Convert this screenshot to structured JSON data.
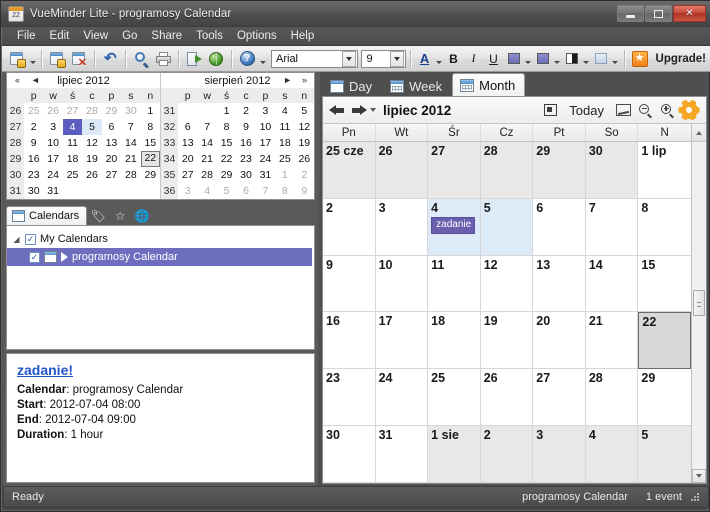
{
  "window": {
    "title": "VueMinder Lite - programosy Calendar",
    "app_icon": "calendar-icon",
    "icon_day_number": "22",
    "buttons": {
      "minimize": "minimize",
      "maximize": "maximize",
      "close": "✕"
    }
  },
  "menubar": {
    "items": [
      "File",
      "Edit",
      "View",
      "Go",
      "Share",
      "Tools",
      "Options",
      "Help"
    ]
  },
  "toolbar": {
    "buttons": [
      {
        "name": "new-event-icon",
        "label": "New Event"
      },
      {
        "name": "new-task-icon",
        "label": "New Task"
      },
      {
        "name": "delete-icon",
        "label": "Delete"
      },
      {
        "name": "undo-icon",
        "label": "Undo"
      },
      {
        "name": "search-icon",
        "label": "Search"
      },
      {
        "name": "print-icon",
        "label": "Print"
      },
      {
        "name": "import-icon",
        "label": "Import"
      },
      {
        "name": "globe-icon",
        "label": "Online"
      },
      {
        "name": "help-icon",
        "label": "Help"
      }
    ],
    "font_name": "Arial",
    "font_size": "9",
    "font_color_label": "A",
    "bold_label": "B",
    "italic_label": "I",
    "underline_label": "U",
    "upgrade_label": "Upgrade!",
    "upgrade_icon": "star-icon"
  },
  "minicals": [
    {
      "title": "lipiec 2012",
      "nav_prev_all": "«",
      "nav_prev": "◄",
      "nav_next": "",
      "nav_next_all": "",
      "dow": [
        "p",
        "w",
        "ś",
        "c",
        "p",
        "s",
        "n"
      ],
      "weeks": [
        {
          "num": "26",
          "days": [
            {
              "d": "25",
              "s": "out"
            },
            {
              "d": "26",
              "s": "out"
            },
            {
              "d": "27",
              "s": "out"
            },
            {
              "d": "28",
              "s": "out"
            },
            {
              "d": "29",
              "s": "out"
            },
            {
              "d": "30",
              "s": "out"
            },
            {
              "d": "1",
              "s": ""
            }
          ]
        },
        {
          "num": "27",
          "days": [
            {
              "d": "2",
              "s": ""
            },
            {
              "d": "3",
              "s": ""
            },
            {
              "d": "4",
              "s": "sel"
            },
            {
              "d": "5",
              "s": "sel2"
            },
            {
              "d": "6",
              "s": ""
            },
            {
              "d": "7",
              "s": ""
            },
            {
              "d": "8",
              "s": ""
            }
          ]
        },
        {
          "num": "28",
          "days": [
            {
              "d": "9",
              "s": ""
            },
            {
              "d": "10",
              "s": ""
            },
            {
              "d": "11",
              "s": ""
            },
            {
              "d": "12",
              "s": ""
            },
            {
              "d": "13",
              "s": ""
            },
            {
              "d": "14",
              "s": ""
            },
            {
              "d": "15",
              "s": ""
            }
          ]
        },
        {
          "num": "29",
          "days": [
            {
              "d": "16",
              "s": ""
            },
            {
              "d": "17",
              "s": ""
            },
            {
              "d": "18",
              "s": ""
            },
            {
              "d": "19",
              "s": ""
            },
            {
              "d": "20",
              "s": ""
            },
            {
              "d": "21",
              "s": ""
            },
            {
              "d": "22",
              "s": "today"
            }
          ]
        },
        {
          "num": "30",
          "days": [
            {
              "d": "23",
              "s": ""
            },
            {
              "d": "24",
              "s": ""
            },
            {
              "d": "25",
              "s": ""
            },
            {
              "d": "26",
              "s": ""
            },
            {
              "d": "27",
              "s": ""
            },
            {
              "d": "28",
              "s": ""
            },
            {
              "d": "29",
              "s": ""
            }
          ]
        },
        {
          "num": "31",
          "days": [
            {
              "d": "30",
              "s": ""
            },
            {
              "d": "31",
              "s": ""
            },
            {
              "d": "",
              "s": ""
            },
            {
              "d": "",
              "s": ""
            },
            {
              "d": "",
              "s": ""
            },
            {
              "d": "",
              "s": ""
            },
            {
              "d": "",
              "s": ""
            }
          ]
        }
      ]
    },
    {
      "title": "sierpień 2012",
      "nav_prev_all": "",
      "nav_prev": "",
      "nav_next": "►",
      "nav_next_all": "»",
      "dow": [
        "p",
        "w",
        "ś",
        "c",
        "p",
        "s",
        "n"
      ],
      "weeks": [
        {
          "num": "31",
          "days": [
            {
              "d": "",
              "s": ""
            },
            {
              "d": "",
              "s": ""
            },
            {
              "d": "1",
              "s": ""
            },
            {
              "d": "2",
              "s": ""
            },
            {
              "d": "3",
              "s": ""
            },
            {
              "d": "4",
              "s": ""
            },
            {
              "d": "5",
              "s": ""
            }
          ]
        },
        {
          "num": "32",
          "days": [
            {
              "d": "6",
              "s": ""
            },
            {
              "d": "7",
              "s": ""
            },
            {
              "d": "8",
              "s": ""
            },
            {
              "d": "9",
              "s": ""
            },
            {
              "d": "10",
              "s": ""
            },
            {
              "d": "11",
              "s": ""
            },
            {
              "d": "12",
              "s": ""
            }
          ]
        },
        {
          "num": "33",
          "days": [
            {
              "d": "13",
              "s": ""
            },
            {
              "d": "14",
              "s": ""
            },
            {
              "d": "15",
              "s": ""
            },
            {
              "d": "16",
              "s": ""
            },
            {
              "d": "17",
              "s": ""
            },
            {
              "d": "18",
              "s": ""
            },
            {
              "d": "19",
              "s": ""
            }
          ]
        },
        {
          "num": "34",
          "days": [
            {
              "d": "20",
              "s": ""
            },
            {
              "d": "21",
              "s": ""
            },
            {
              "d": "22",
              "s": ""
            },
            {
              "d": "23",
              "s": ""
            },
            {
              "d": "24",
              "s": ""
            },
            {
              "d": "25",
              "s": ""
            },
            {
              "d": "26",
              "s": ""
            }
          ]
        },
        {
          "num": "35",
          "days": [
            {
              "d": "27",
              "s": ""
            },
            {
              "d": "28",
              "s": ""
            },
            {
              "d": "29",
              "s": ""
            },
            {
              "d": "30",
              "s": ""
            },
            {
              "d": "31",
              "s": ""
            },
            {
              "d": "1",
              "s": "out"
            },
            {
              "d": "2",
              "s": "out"
            }
          ]
        },
        {
          "num": "36",
          "days": [
            {
              "d": "3",
              "s": "out"
            },
            {
              "d": "4",
              "s": "out"
            },
            {
              "d": "5",
              "s": "out"
            },
            {
              "d": "6",
              "s": "out"
            },
            {
              "d": "7",
              "s": "out"
            },
            {
              "d": "8",
              "s": "out"
            },
            {
              "d": "9",
              "s": "out"
            }
          ]
        }
      ]
    }
  ],
  "sidebar": {
    "tabs": [
      {
        "label": "Calendars",
        "icon": "calendar-icon",
        "active": true
      },
      {
        "label": "",
        "icon": "tag-icon",
        "active": false
      },
      {
        "label": "",
        "icon": "star-icon",
        "active": false
      },
      {
        "label": "",
        "icon": "globe-icon",
        "active": false
      }
    ],
    "tree": [
      {
        "label": "My Calendars",
        "checked": true,
        "level": 0,
        "selected": false
      },
      {
        "label": "programosy Calendar",
        "checked": true,
        "level": 1,
        "selected": true
      }
    ]
  },
  "details": {
    "title": "zadanie!",
    "rows": [
      {
        "label": "Calendar",
        "value": "programosy Calendar"
      },
      {
        "label": "Start",
        "value": "2012-07-04 08:00"
      },
      {
        "label": "End",
        "value": "2012-07-04 09:00"
      },
      {
        "label": "Duration",
        "value": "1 hour"
      }
    ]
  },
  "view_tabs": [
    {
      "label": "Day",
      "icon": "day-view-icon",
      "active": false
    },
    {
      "label": "Week",
      "icon": "week-view-icon",
      "active": false
    },
    {
      "label": "Month",
      "icon": "month-view-icon",
      "active": true
    }
  ],
  "navbar": {
    "prev": "back-arrow",
    "next": "forward-arrow",
    "dropdown": "chevron-down-icon",
    "title": "lipiec 2012",
    "select_icon": "select-icon",
    "today_label": "Today",
    "fit_icon": "fit-icon",
    "zoom_out_icon": "zoom-out-icon",
    "zoom_in_icon": "zoom-in-icon",
    "settings_icon": "gear-icon"
  },
  "month_view": {
    "dow_headers": [
      "Pn",
      "Wt",
      "Śr",
      "Cz",
      "Pt",
      "So",
      "N"
    ],
    "cells": [
      {
        "label": "25 cze",
        "state": "other"
      },
      {
        "label": "26",
        "state": "other"
      },
      {
        "label": "27",
        "state": "other"
      },
      {
        "label": "28",
        "state": "other"
      },
      {
        "label": "29",
        "state": "other"
      },
      {
        "label": "30",
        "state": "other"
      },
      {
        "label": "1 lip",
        "state": "normal"
      },
      {
        "label": "2",
        "state": "normal"
      },
      {
        "label": "3",
        "state": "normal"
      },
      {
        "label": "4",
        "state": "hl",
        "event": "zadanie"
      },
      {
        "label": "5",
        "state": "hl"
      },
      {
        "label": "6",
        "state": "normal"
      },
      {
        "label": "7",
        "state": "normal"
      },
      {
        "label": "8",
        "state": "normal"
      },
      {
        "label": "9",
        "state": "normal"
      },
      {
        "label": "10",
        "state": "normal"
      },
      {
        "label": "11",
        "state": "normal"
      },
      {
        "label": "12",
        "state": "normal"
      },
      {
        "label": "13",
        "state": "normal"
      },
      {
        "label": "14",
        "state": "normal"
      },
      {
        "label": "15",
        "state": "normal"
      },
      {
        "label": "16",
        "state": "normal"
      },
      {
        "label": "17",
        "state": "normal"
      },
      {
        "label": "18",
        "state": "normal"
      },
      {
        "label": "19",
        "state": "normal"
      },
      {
        "label": "20",
        "state": "normal"
      },
      {
        "label": "21",
        "state": "normal"
      },
      {
        "label": "22",
        "state": "today"
      },
      {
        "label": "23",
        "state": "normal"
      },
      {
        "label": "24",
        "state": "normal"
      },
      {
        "label": "25",
        "state": "normal"
      },
      {
        "label": "26",
        "state": "normal"
      },
      {
        "label": "27",
        "state": "normal"
      },
      {
        "label": "28",
        "state": "normal"
      },
      {
        "label": "29",
        "state": "normal"
      },
      {
        "label": "30",
        "state": "normal"
      },
      {
        "label": "31",
        "state": "normal"
      },
      {
        "label": "1 sie",
        "state": "other"
      },
      {
        "label": "2",
        "state": "other"
      },
      {
        "label": "3",
        "state": "other"
      },
      {
        "label": "4",
        "state": "other"
      },
      {
        "label": "5",
        "state": "other"
      }
    ]
  },
  "statusbar": {
    "message": "Ready",
    "calendar": "programosy Calendar",
    "count": "1 event"
  },
  "colors": {
    "accent_purple": "#6a5fae",
    "selection_blue": "#6d6fbe",
    "highlight_cell": "#dcebf7",
    "link_blue": "#2255cc",
    "gear_orange": "#f5a623",
    "close_red": "#c94a3a"
  }
}
